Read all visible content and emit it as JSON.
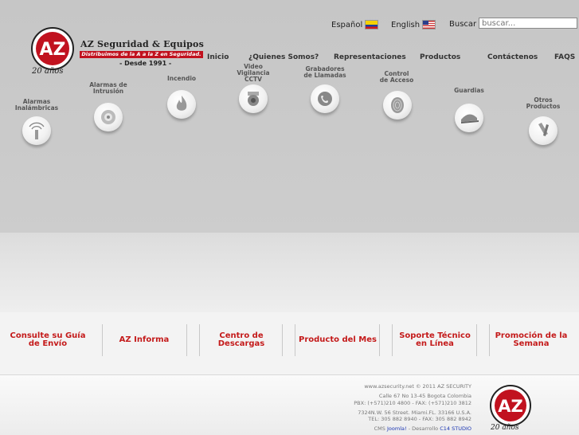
{
  "languages": [
    {
      "label": "Español",
      "flag": "colombia-flag-icon"
    },
    {
      "label": "English",
      "flag": "us-flag-icon"
    }
  ],
  "search": {
    "label": "Buscar",
    "placeholder": "buscar..."
  },
  "brand": {
    "name": "AZ Seguridad & Equipos",
    "tagline": "Distribuimos de la A a la Z en Seguridad.",
    "since": "- Desde 1991 -",
    "anniversary": "20 años",
    "logo_letters": "AZ",
    "accent_color": "#c1121f"
  },
  "nav": [
    "Inicio",
    "¿Quienes Somos?",
    "Representaciones",
    "Productos",
    "Contáctenos",
    "FAQS"
  ],
  "products": [
    {
      "label": "Alarmas\nInalámbricas",
      "icon": "wireless-alarm-icon"
    },
    {
      "label": "Alarmas de\nIntrusión",
      "icon": "intrusion-alarm-icon"
    },
    {
      "label": "Incendio",
      "icon": "fire-icon"
    },
    {
      "label": "Video\nVigilancia\nCCTV",
      "icon": "cctv-camera-icon"
    },
    {
      "label": "Grabadores\nde Llamadas",
      "icon": "call-recorder-icon"
    },
    {
      "label": "Control\nde Acceso",
      "icon": "fingerprint-icon"
    },
    {
      "label": "Guardias",
      "icon": "guard-cap-icon"
    },
    {
      "label": "Otros\nProductos",
      "icon": "other-products-icon"
    }
  ],
  "services": [
    "Consulte su Guía de Envío",
    "AZ Informa",
    "Centro de Descargas",
    "Producto del Mes",
    "Soporte Técnico en Línea",
    "Promoción de la Semana"
  ],
  "footer": {
    "copyright": "www.azsecurity.net © 2011 AZ SECURITY",
    "address_co": "Calle 67 No 13-45 Bogota Colombia",
    "phones_co": "PBX: (+571)210 4800 - FAX: (+571)210 3812",
    "address_us": "7324N.W. 56 Street. Miami.FL. 33166 U.S.A.",
    "phones_us": "TEL: 305 882 8940 - FAX: 305 882 8942",
    "cms_prefix": "CMS",
    "cms_link": "Joomla!",
    "dev_prefix": "- Desarrollo",
    "dev_link": "C14 STUDIO"
  }
}
